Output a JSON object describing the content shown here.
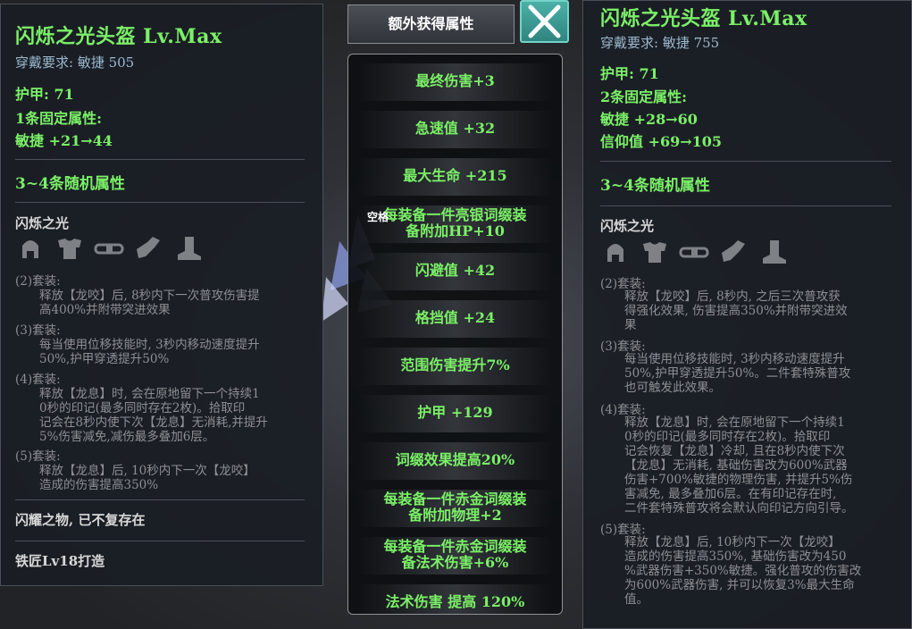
{
  "left_item": {
    "title": "闪烁之光头盔 Lv.Max",
    "requirement": "穿戴要求: 敏捷 505",
    "armor": "护甲: 71",
    "fixed_count": "1条固定属性:",
    "fixed_attrs": [
      "敏捷 +21→44"
    ],
    "random_header": "3~4条随机属性",
    "set_name": "闪烁之光",
    "set_icons": [
      "helmet-icon",
      "armor-icon",
      "belt-icon",
      "gauntlet-icon",
      "boots-icon"
    ],
    "bonuses": [
      {
        "label": "(2)套装:",
        "text": [
          "释放【龙咬】后, 8秒内下一次普攻伤害提",
          "高400%并附带突进效果"
        ]
      },
      {
        "label": "(3)套装:",
        "text": [
          "每当使用位移技能时, 3秒内移动速度提升",
          "50%,护甲穿透提升50%"
        ]
      },
      {
        "label": "(4)套装:",
        "text": [
          "释放【龙息】时, 会在原地留下一个持续1",
          "0秒的印记(最多同时存在2枚)。拾取印",
          "记会在8秒内使下次【龙息】无消耗,并提升",
          "5%伤害减免,减伤最多叠加6层。"
        ]
      },
      {
        "label": "(5)套装:",
        "text": [
          "释放【龙息】后, 10秒内下一次【龙咬】",
          "造成的伤害提高350%"
        ]
      }
    ],
    "flavor": "闪耀之物, 已不复存在",
    "crafted_by": "铁匠Lv18打造"
  },
  "extra_tab_label": "额外获得属性",
  "space_hint": "空格",
  "extra_attrs": [
    [
      "最终伤害+3"
    ],
    [
      "急速值 +32"
    ],
    [
      "最大生命 +215"
    ],
    [
      "每装备一件亮银词缀装",
      "备附加HP+10"
    ],
    [
      "闪避值 +42"
    ],
    [
      "格挡值 +24"
    ],
    [
      "范围伤害提升7%"
    ],
    [
      "护甲 +129"
    ],
    [
      "词缀效果提高20%"
    ],
    [
      "每装备一件赤金词缀装",
      "备附加物理+2"
    ],
    [
      "每装备一件赤金词缀装",
      "备法术伤害+6%"
    ],
    [
      "法术伤害 提高 120%"
    ]
  ],
  "right_item": {
    "title": "闪烁之光头盔 Lv.Max",
    "requirement": "穿戴要求: 敏捷 755",
    "armor": "护甲: 71",
    "fixed_count": "2条固定属性:",
    "fixed_attrs": [
      "敏捷 +28→60",
      "信仰值 +69→105"
    ],
    "random_header": "3~4条随机属性",
    "set_name": "闪烁之光",
    "set_icons": [
      "helmet-icon",
      "armor-icon",
      "belt-icon",
      "gauntlet-icon",
      "boots-icon"
    ],
    "bonuses": [
      {
        "label": "(2)套装:",
        "text": [
          "释放【龙咬】后, 8秒内, 之后三次普攻获",
          "得强化效果, 伤害提高350%并附带突进效",
          "果"
        ]
      },
      {
        "label": "(3)套装:",
        "text": [
          "每当使用位移技能时, 3秒内移动速度提升",
          "50%,护甲穿透提升50%。二件套特殊普攻",
          "也可触发此效果。"
        ]
      },
      {
        "label": "(4)套装:",
        "text": [
          "释放【龙息】时, 会在原地留下一个持续1",
          "0秒的印记(最多同时存在2枚)。拾取印",
          "记会恢复【龙息】冷却, 且在8秒内使下次",
          "【龙息】无消耗, 基础伤害改为600%武器",
          "伤害+700%敏捷的物理伤害, 并提升5%伤",
          "害减免, 最多叠加6层。在有印记存在时,",
          "二件套特殊普攻将会默认向印记方向引导。"
        ]
      },
      {
        "label": "(5)套装:",
        "text": [
          "释放【龙息】后, 10秒内下一次【龙咬】",
          "造成的伤害提高350%, 基础伤害改为450",
          "%武器伤害+350%敏捷。强化普攻的伤害改",
          "为600%武器伤害, 并可以恢复3%最大生命",
          "值。"
        ]
      }
    ]
  }
}
